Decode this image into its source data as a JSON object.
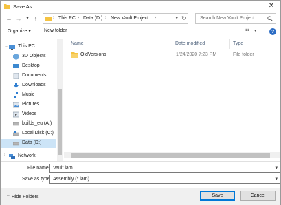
{
  "window": {
    "title": "Save As"
  },
  "address": {
    "crumbs": [
      "This PC",
      "Data (D:)",
      "New Vault Project"
    ],
    "separator": "›"
  },
  "search": {
    "placeholder": "Search New Vault Project"
  },
  "toolbar": {
    "organize": "Organize ▾",
    "new_folder": "New folder"
  },
  "nav": {
    "items": [
      {
        "label": "This PC",
        "icon": "computer-icon",
        "color": "#4a8fd6"
      },
      {
        "label": "3D Objects",
        "icon": "cube-icon",
        "color": "#6aa6dc"
      },
      {
        "label": "Desktop",
        "icon": "desktop-icon",
        "color": "#3c89d0"
      },
      {
        "label": "Documents",
        "icon": "document-icon",
        "color": "#7b8a9a"
      },
      {
        "label": "Downloads",
        "icon": "download-icon",
        "color": "#2f7fd1"
      },
      {
        "label": "Music",
        "icon": "music-icon",
        "color": "#2f7fd1"
      },
      {
        "label": "Pictures",
        "icon": "picture-icon",
        "color": "#7b8a9a"
      },
      {
        "label": "Videos",
        "icon": "video-icon",
        "color": "#7b8a9a"
      },
      {
        "label": "builds_eu (A:)",
        "icon": "network-drive-icon",
        "color": "#8a8a8a"
      },
      {
        "label": "Local Disk (C:)",
        "icon": "disk-icon",
        "color": "#8a8a8a"
      },
      {
        "label": "Data (D:)",
        "icon": "disk-icon",
        "color": "#8a8a8a"
      },
      {
        "label": "Network",
        "icon": "network-icon",
        "color": "#4a8fd6"
      }
    ]
  },
  "columns": {
    "name": "Name",
    "date": "Date modified",
    "type": "Type"
  },
  "files": [
    {
      "name": "OldVersions",
      "date": "1/24/2020 7:23 PM",
      "type": "File folder"
    }
  ],
  "form": {
    "filename_label": "File name:",
    "filename_value": "Vault.iam",
    "savetype_label": "Save as type:",
    "savetype_value": "Assembly (*.iam)"
  },
  "footer": {
    "hide_folders": "Hide Folders",
    "save": "Save",
    "cancel": "Cancel"
  },
  "colors": {
    "selection": "#cce4f7",
    "folder": "#f5c342",
    "accent": "#0078d7"
  }
}
